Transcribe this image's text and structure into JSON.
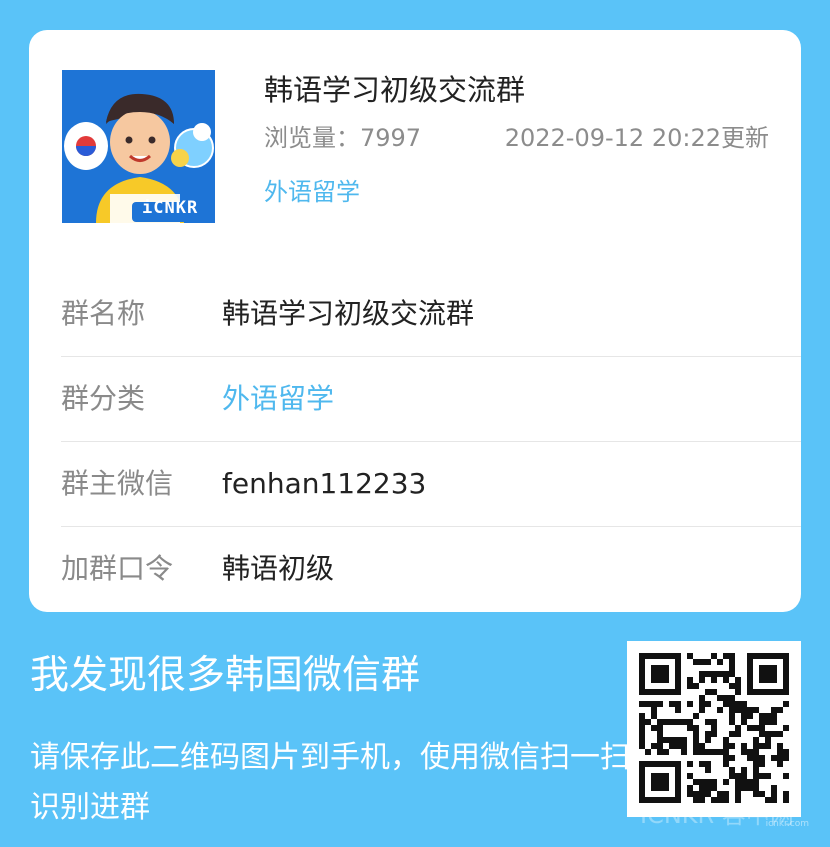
{
  "group": {
    "title": "韩语学习初级交流群",
    "views_label": "浏览量：",
    "views": "7997",
    "updated": "2022-09-12 20:22更新",
    "category": "外语留学",
    "avatar_logo_text": "iCNKR"
  },
  "details": [
    {
      "label": "群名称",
      "value": "韩语学习初级交流群"
    },
    {
      "label": "群分类",
      "value": "外语留学"
    },
    {
      "label": "群主微信",
      "value": "fenhan112233"
    },
    {
      "label": "加群口令",
      "value": "韩语初级"
    }
  ],
  "footer": {
    "title": "我发现很多韩国微信群",
    "description": "请保存此二维码图片到手机，使用微信扫一扫识别进群"
  },
  "watermark": {
    "text": "ICNKR 容中网",
    "url": "icnkr.com"
  },
  "colors": {
    "background": "#5ac3f8",
    "accent": "#4fb8ee",
    "card": "#ffffff"
  }
}
